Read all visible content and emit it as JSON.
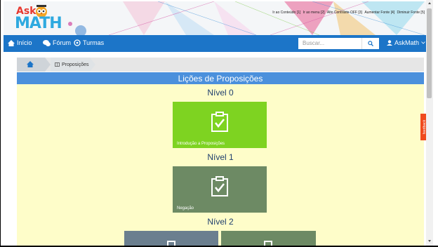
{
  "header": {
    "logo_ask": "Ask",
    "logo_math": "MATH",
    "accessibility": [
      "Ir ao Conteúdo [1]",
      "Ir ao menu [2]",
      "Alto Contraste OFF [3]",
      "Aumentar Fonte [4]",
      "Diminuir Fonte [5]"
    ]
  },
  "nav": {
    "home": "Início",
    "forum": "Fórum",
    "classes": "Turmas",
    "search_placeholder": "Buscar...",
    "user": "AskMath"
  },
  "breadcrumb": {
    "current": "Proposições"
  },
  "main": {
    "title": "Lições de Proposições",
    "levels": [
      {
        "title": "Nível 0",
        "tiles": [
          {
            "label": "Introdução a Proposições",
            "color": "#7ed321"
          }
        ]
      },
      {
        "title": "Nível 1",
        "tiles": [
          {
            "label": "Negação",
            "color": "#6d8a64"
          }
        ]
      },
      {
        "title": "Nível 2",
        "tiles": [
          {
            "label": "",
            "color": "#6b7f8f"
          },
          {
            "label": "",
            "color": "#6d8a64"
          }
        ]
      }
    ]
  },
  "feedback": "feedback",
  "colors": {
    "nav_blue": "#1c75c8",
    "header_blue": "#4b90dc",
    "content_bg": "#fefdc9",
    "tile_green": "#7ed321",
    "tile_gray_green": "#6d8a64",
    "tile_slate": "#6b7f8f",
    "feedback_orange": "#f04a1d"
  }
}
